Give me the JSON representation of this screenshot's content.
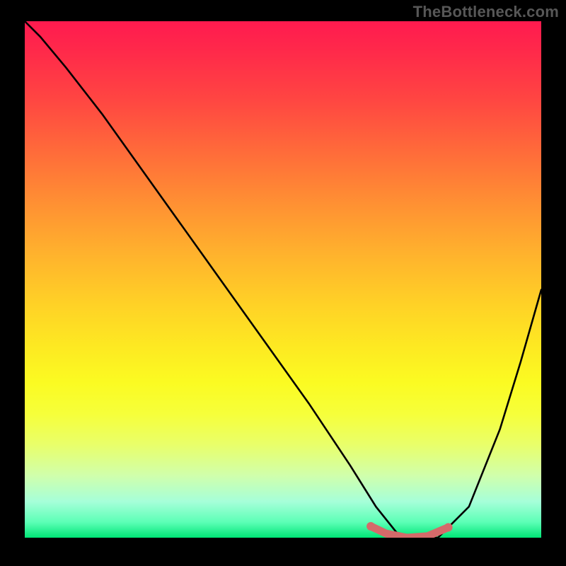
{
  "watermark": "TheBottleneck.com",
  "chart_data": {
    "type": "line",
    "title": "",
    "xlabel": "",
    "ylabel": "",
    "xlim": [
      0,
      1
    ],
    "ylim": [
      0,
      1
    ],
    "series": [
      {
        "name": "bottleneck-curve",
        "x": [
          0.0,
          0.03,
          0.08,
          0.15,
          0.25,
          0.35,
          0.45,
          0.55,
          0.63,
          0.68,
          0.72,
          0.76,
          0.8,
          0.86,
          0.92,
          0.96,
          1.0
        ],
        "values": [
          1.0,
          0.97,
          0.91,
          0.82,
          0.68,
          0.54,
          0.4,
          0.26,
          0.14,
          0.06,
          0.01,
          0.0,
          0.0,
          0.06,
          0.21,
          0.34,
          0.48
        ]
      },
      {
        "name": "highlight-band",
        "x": [
          0.67,
          0.7,
          0.74,
          0.78,
          0.82
        ],
        "values": [
          0.022,
          0.008,
          0.0,
          0.003,
          0.02
        ]
      }
    ],
    "colors": {
      "curve": "#000000",
      "highlight": "#d46a6a",
      "gradient_top": "#ff1a4f",
      "gradient_mid": "#ffd226",
      "gradient_bottom": "#00e676"
    }
  }
}
